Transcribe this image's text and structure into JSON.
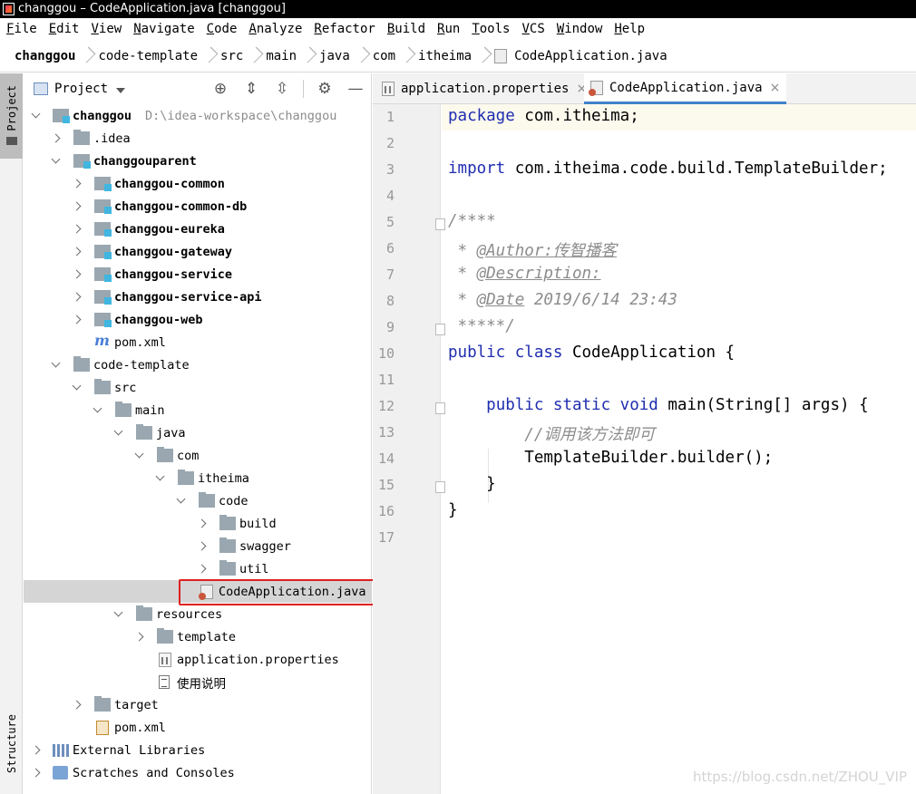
{
  "window": {
    "title": "changgou – CodeApplication.java [changgou]"
  },
  "menu": [
    "File",
    "Edit",
    "View",
    "Navigate",
    "Code",
    "Analyze",
    "Refactor",
    "Build",
    "Run",
    "Tools",
    "VCS",
    "Window",
    "Help"
  ],
  "breadcrumb": [
    "changgou",
    "code-template",
    "src",
    "main",
    "java",
    "com",
    "itheima",
    "CodeApplication.java"
  ],
  "sidebar": {
    "project_tab": "Project",
    "structure_tab": "Structure"
  },
  "panel": {
    "title": "Project"
  },
  "tree": [
    {
      "label": "changgou",
      "path": "D:\\idea-workspace\\changgou"
    },
    {
      "label": ".idea"
    },
    {
      "label": "changgouparent"
    },
    {
      "label": "changgou-common"
    },
    {
      "label": "changgou-common-db"
    },
    {
      "label": "changgou-eureka"
    },
    {
      "label": "changgou-gateway"
    },
    {
      "label": "changgou-service"
    },
    {
      "label": "changgou-service-api"
    },
    {
      "label": "changgou-web"
    },
    {
      "label": "pom.xml"
    },
    {
      "label": "code-template"
    },
    {
      "label": "src"
    },
    {
      "label": "main"
    },
    {
      "label": "java"
    },
    {
      "label": "com"
    },
    {
      "label": "itheima"
    },
    {
      "label": "code"
    },
    {
      "label": "build"
    },
    {
      "label": "swagger"
    },
    {
      "label": "util"
    },
    {
      "label": "CodeApplication.java"
    },
    {
      "label": "resources"
    },
    {
      "label": "template"
    },
    {
      "label": "application.properties"
    },
    {
      "label": "使用说明"
    },
    {
      "label": "target"
    },
    {
      "label": "pom.xml"
    },
    {
      "label": "External Libraries"
    },
    {
      "label": "Scratches and Consoles"
    }
  ],
  "editor": {
    "tabs": [
      {
        "label": "application.properties",
        "close": "×"
      },
      {
        "label": "CodeApplication.java",
        "close": "×"
      }
    ],
    "line_numbers": [
      "1",
      "2",
      "3",
      "4",
      "5",
      "6",
      "7",
      "8",
      "9",
      "10",
      "11",
      "12",
      "13",
      "14",
      "15",
      "16",
      "17"
    ],
    "code": {
      "l1_kw": "package",
      "l1_rest": " com.itheima;",
      "l3_kw": "import",
      "l3_rest": " com.itheima.code.build.TemplateBuilder;",
      "l5": "/****",
      "l6_pre": " * ",
      "l6_tag": "@Author:传智播客",
      "l7_pre": " * ",
      "l7_tag": "@Description:",
      "l8_pre": " * ",
      "l8_tag": "@Date",
      "l8_rest": " 2019/6/14 23:43",
      "l9": " *****/",
      "l10_kw": "public class",
      "l10_rest": " CodeApplication {",
      "l12_indent": "    ",
      "l12_kw": "public static void",
      "l12_rest": " main(String[] args) {",
      "l13": "        //调用该方法即可",
      "l14": "        TemplateBuilder.builder();",
      "l15": "    }",
      "l16": "}"
    }
  },
  "watermark": "https://blog.csdn.net/ZHOU_VIP"
}
